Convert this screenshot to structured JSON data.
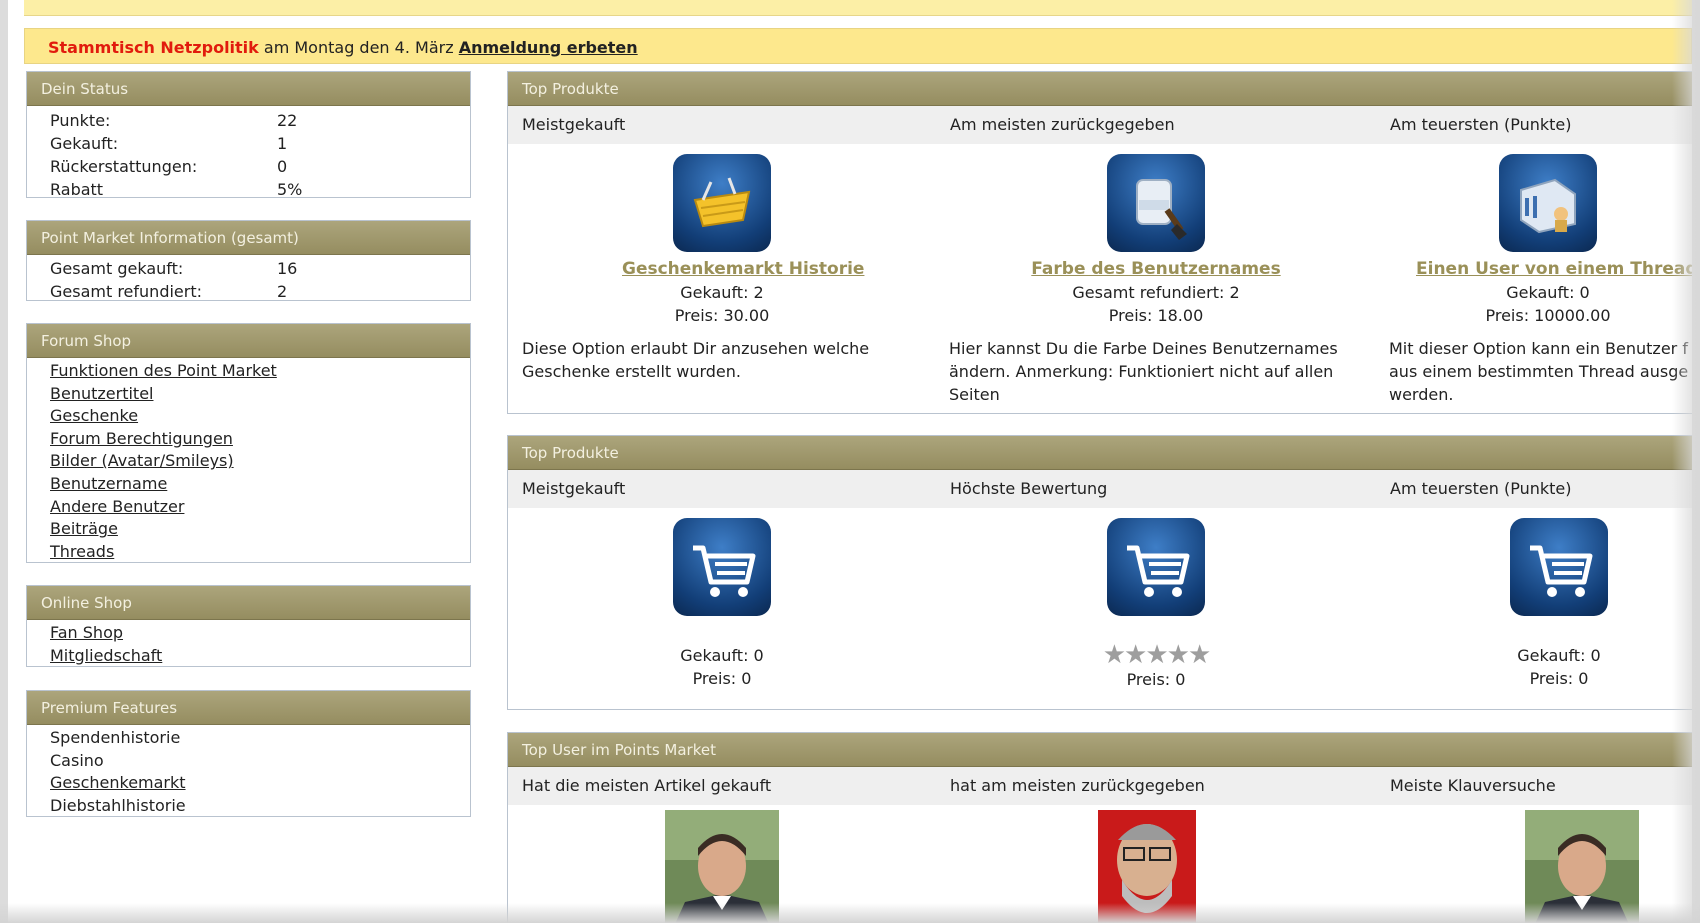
{
  "notice": {
    "red_text": "Stammtisch Netzpolitik",
    "middle_text": " am Montag den 4. März ",
    "link_text": "Anmeldung erbeten"
  },
  "status": {
    "title": "Dein Status",
    "rows": [
      {
        "k": "Punkte:",
        "v": "22"
      },
      {
        "k": "Gekauft:",
        "v": "1"
      },
      {
        "k": "Rückerstattungen:",
        "v": "0"
      },
      {
        "k": "Rabatt",
        "v": "5%"
      }
    ]
  },
  "pm_info": {
    "title": "Point Market Information (gesamt)",
    "rows": [
      {
        "k": "Gesamt gekauft:",
        "v": "16"
      },
      {
        "k": "Gesamt refundiert:",
        "v": "2"
      }
    ]
  },
  "forum_shop": {
    "title": "Forum Shop",
    "items": [
      "Funktionen des Point Market",
      "Benutzertitel",
      "Geschenke",
      "Forum Berechtigungen",
      "Bilder (Avatar/Smileys)",
      "Benutzername",
      "Andere Benutzer",
      "Beiträge",
      "Threads"
    ]
  },
  "online_shop": {
    "title": "Online Shop",
    "items": [
      "Fan Shop",
      "Mitgliedschaft"
    ]
  },
  "premium": {
    "title": "Premium Features",
    "items": [
      "Spendenhistorie",
      "Casino",
      "Geschenkemarkt",
      "Diebstahlhistorie"
    ]
  },
  "top1": {
    "title": "Top Produkte",
    "cols": [
      "Meistgekauft",
      "Am meisten zurückgegeben",
      "Am teuersten (Punkte)"
    ],
    "products": [
      {
        "icon": "basket-icon",
        "title": "Geschenkemarkt Historie",
        "line1": "Gekauft: 2",
        "line2": "Preis: 30.00",
        "desc": "Diese Option erlaubt Dir anzusehen welche Geschenke erstellt wurden."
      },
      {
        "icon": "paint-bucket-icon",
        "title": "Farbe des Benutzernames",
        "line1": "Gesamt refundiert: 2",
        "line2": "Preis: 18.00",
        "desc": "Hier kannst Du die Farbe Deines Benutzernames ändern. Anmerkung: Funktioniert nicht auf allen Seiten"
      },
      {
        "icon": "user-block-icon",
        "title": "Einen User von einem Thread ve",
        "line1": "Gekauft: 0",
        "line2": "Preis: 10000.00",
        "desc": "Mit dieser Option kann ein Benutzer f aus einem bestimmten Thread ausge werden."
      }
    ]
  },
  "top2": {
    "title": "Top Produkte",
    "cols": [
      "Meistgekauft",
      "Höchste Bewertung",
      "Am teuersten (Punkte)"
    ],
    "products": [
      {
        "icon": "cart-icon",
        "line1": "Gekauft: 0",
        "line2": "Preis: 0"
      },
      {
        "icon": "cart-icon",
        "line1": "",
        "line2": "Preis: 0",
        "rating": 0,
        "stars": "★★★★★"
      },
      {
        "icon": "cart-icon",
        "line1": "Gekauft: 0",
        "line2": "Preis: 0"
      }
    ]
  },
  "top_users": {
    "title": "Top User im Points Market",
    "cols": [
      "Hat die meisten Artikel gekauft",
      "hat am meisten zurückgegeben",
      "Meiste Klauversuche"
    ]
  }
}
